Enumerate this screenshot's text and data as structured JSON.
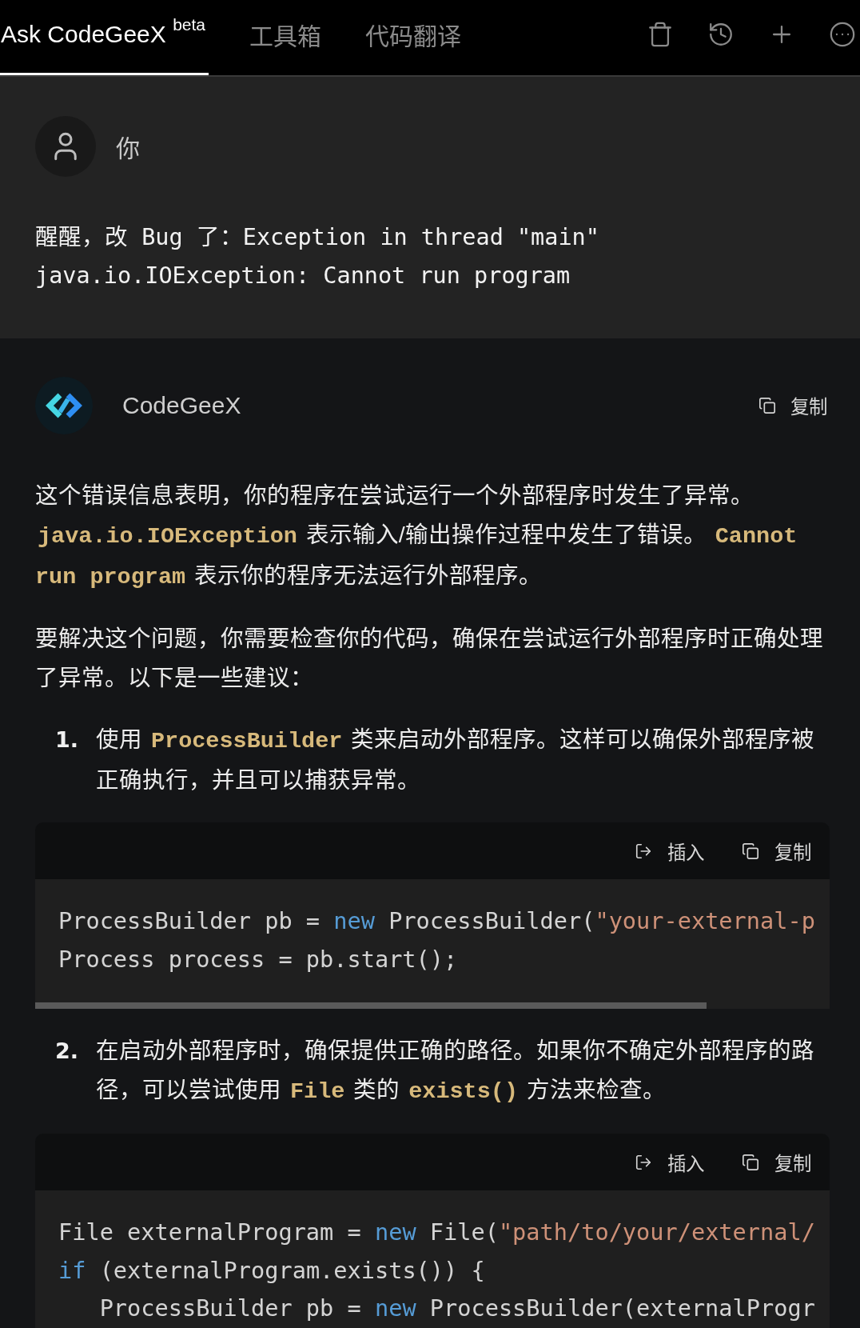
{
  "tabs": [
    {
      "label": "Ask CodeGeeX $^{beta}$",
      "selected": true
    },
    {
      "label": "工具箱",
      "selected": false
    },
    {
      "label": "代码翻译",
      "selected": false
    }
  ],
  "user_message": {
    "author": "你",
    "text": "醒醒，改 Bug 了：Exception in thread \"main\" java.io.IOException: Cannot run program"
  },
  "response": {
    "author": "CodeGeeX",
    "copy_label": "复制",
    "blocks": [
      {
        "kind": "paragraph",
        "segments": [
          {
            "kind": "text",
            "text": "这个错误信息表明，你的程序在尝试运行一个外部程序时发生了异常。 "
          },
          {
            "kind": "code",
            "text": "java.io.IOException"
          },
          {
            "kind": "text",
            "text": " 表示输入/输出操作过程中发生了错误。 "
          },
          {
            "kind": "code",
            "text": "Cannot run program"
          },
          {
            "kind": "text",
            "text": " 表示你的程序无法运行外部程序。"
          }
        ]
      },
      {
        "kind": "paragraph",
        "segments": [
          {
            "kind": "text",
            "text": "要解决这个问题，你需要检查你的代码，确保在尝试运行外部程序时正确处理了异常。以下是一些建议："
          }
        ]
      },
      {
        "kind": "list_item",
        "number": "1.",
        "segments": [
          {
            "kind": "text",
            "text": "使用 "
          },
          {
            "kind": "code",
            "text": "ProcessBuilder"
          },
          {
            "kind": "text",
            "text": " 类来启动外部程序。这样可以确保外部程序被正确执行，并且可以捕获异常。"
          }
        ]
      },
      {
        "kind": "code_block",
        "actions": [
          {
            "kind": "insert",
            "label": "插入"
          },
          {
            "kind": "copy",
            "label": "复制"
          }
        ],
        "lines": [
          [
            {
              "kind": "plain",
              "text": "ProcessBuilder pb = "
            },
            {
              "kind": "keyword",
              "text": "new"
            },
            {
              "kind": "plain",
              "text": " ProcessBuilder("
            },
            {
              "kind": "string",
              "text": "\"your-external-p"
            }
          ],
          [
            {
              "kind": "plain",
              "text": "Process process = pb.start();"
            }
          ]
        ]
      },
      {
        "kind": "list_item",
        "number": "2.",
        "segments": [
          {
            "kind": "text",
            "text": "在启动外部程序时，确保提供正确的路径。如果你不确定外部程序的路径，可以尝试使用 "
          },
          {
            "kind": "code",
            "text": "File"
          },
          {
            "kind": "text",
            "text": " 类的 "
          },
          {
            "kind": "code",
            "text": "exists()"
          },
          {
            "kind": "text",
            "text": " 方法来检查。"
          }
        ]
      },
      {
        "kind": "code_block",
        "actions": [
          {
            "kind": "insert",
            "label": "插入"
          },
          {
            "kind": "copy",
            "label": "复制"
          }
        ],
        "lines": [
          [
            {
              "kind": "plain",
              "text": "File externalProgram = "
            },
            {
              "kind": "keyword",
              "text": "new"
            },
            {
              "kind": "plain",
              "text": " File("
            },
            {
              "kind": "string",
              "text": "\"path/to/your/external/"
            }
          ],
          [
            {
              "kind": "keyword",
              "text": "if"
            },
            {
              "kind": "plain",
              "text": " (externalProgram.exists()) {"
            }
          ],
          [
            {
              "kind": "plain",
              "text": "   ProcessBuilder pb = "
            },
            {
              "kind": "keyword",
              "text": "new"
            },
            {
              "kind": "plain",
              "text": " ProcessBuilder(externalProgr"
            }
          ]
        ]
      }
    ]
  }
}
